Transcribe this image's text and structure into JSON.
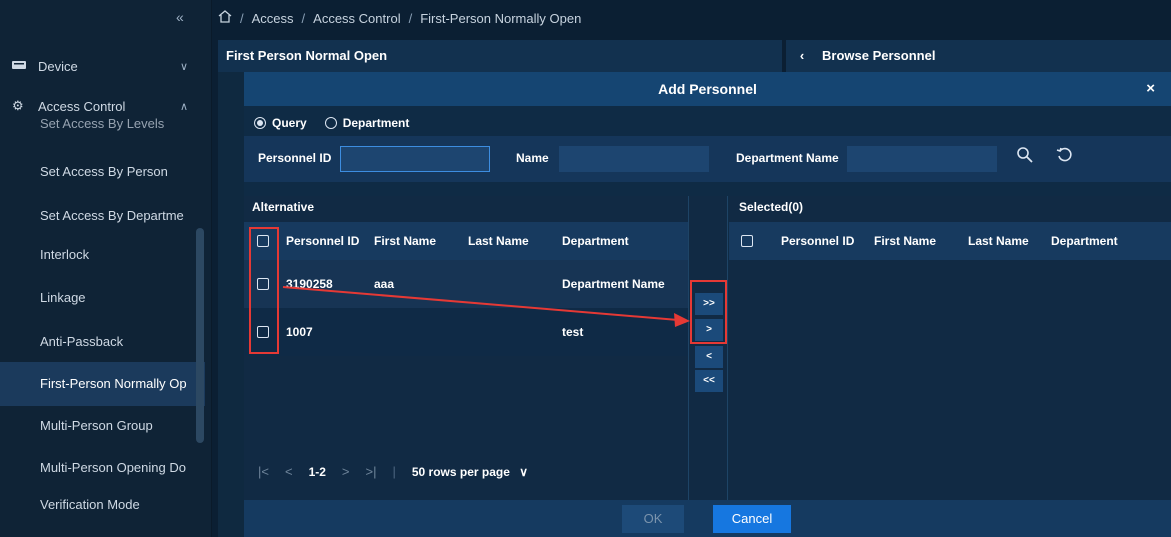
{
  "sidebar": {
    "collapse_glyph": "«",
    "device": {
      "label": "Device",
      "icon": "device-icon"
    },
    "access_control": {
      "label": "Access Control",
      "icon": "gear-icon"
    },
    "items": [
      {
        "label": "Set Access By Levels"
      },
      {
        "label": "Set Access By Person"
      },
      {
        "label": "Set Access By Departme"
      },
      {
        "label": "Interlock"
      },
      {
        "label": "Linkage"
      },
      {
        "label": "Anti-Passback"
      },
      {
        "label": "First-Person Normally Op"
      },
      {
        "label": "Multi-Person Group"
      },
      {
        "label": "Multi-Person Opening Do"
      },
      {
        "label": "Verification Mode"
      }
    ],
    "active_index": 6
  },
  "breadcrumb": {
    "items": [
      "Access",
      "Access Control",
      "First-Person Normally Open"
    ],
    "separator": "/"
  },
  "panels": {
    "left_title": "First Person Normal Open",
    "right_title": "Browse Personnel",
    "back_glyph": "‹"
  },
  "modal": {
    "title": "Add Personnel",
    "close_glyph": "×",
    "radios": [
      {
        "label": "Query",
        "checked": true
      },
      {
        "label": "Department",
        "checked": false
      }
    ],
    "query": {
      "personnel_id_label": "Personnel ID",
      "personnel_id_value": "",
      "name_label": "Name",
      "name_value": "",
      "department_label": "Department Name",
      "department_value": ""
    },
    "alternative": {
      "title": "Alternative",
      "columns": [
        "Personnel ID",
        "First Name",
        "Last Name",
        "Department"
      ],
      "rows": [
        {
          "id": "3190258",
          "first": "aaa",
          "last": "",
          "dept": "Department Name"
        },
        {
          "id": "1007",
          "first": "",
          "last": "",
          "dept": "test"
        }
      ],
      "pager": {
        "first": "|<",
        "prev": "<",
        "range": "1-2",
        "next": ">",
        "last": ">|",
        "rows_per_page": "50 rows per page"
      }
    },
    "transfer": {
      "all_right": ">>",
      "right": ">",
      "left": "<",
      "all_left": "<<"
    },
    "selected": {
      "title": "Selected(0)",
      "columns": [
        "Personnel ID",
        "First Name",
        "Last Name",
        "Department"
      ]
    },
    "ok_label": "OK",
    "cancel_label": "Cancel"
  },
  "colors": {
    "accent": "#1677e0",
    "annotation": "#e53935"
  }
}
